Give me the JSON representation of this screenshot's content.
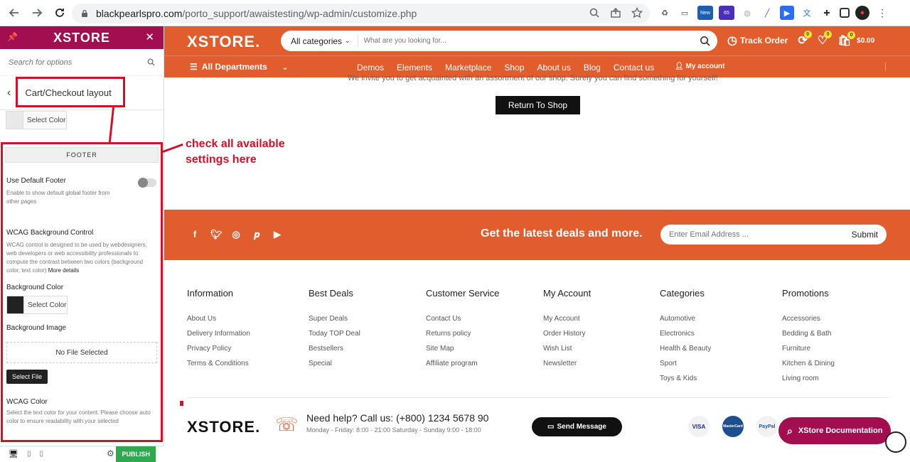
{
  "browser": {
    "url_host": "blackpearlspro.com",
    "url_path": "/porto_support/awaistesting/wp-admin/customize.php",
    "ext_new": "New",
    "ext_count": "65"
  },
  "sidebar": {
    "brand": "XSTORE",
    "search_placeholder": "Search for options",
    "breadcrumb": "Cart/Checkout layout",
    "color_top_label": "Select Color",
    "section_title": "FOOTER",
    "use_default_footer_label": "Use Default Footer",
    "use_default_footer_desc": "Enable to show default global footer from other pages",
    "wcag_bg_label": "WCAG Background Control",
    "wcag_bg_desc": "WCAG control is designed to be used by webdesigners, web developers or web accessibility professionals to compute the contrast between two colors (background color, text color)",
    "more_details": "More details",
    "bg_color_label": "Background Color",
    "bg_color_button": "Select Color",
    "bg_image_label": "Background Image",
    "no_file": "No File Selected",
    "select_file": "Select File",
    "wcag_color_label": "WCAG Color",
    "wcag_color_desc": "Select the text color for your content. Please choose auto color to ensure readability with your selected",
    "publish": "PUBLISH"
  },
  "annotation": {
    "line1": "check all available",
    "line2": "settings here"
  },
  "header": {
    "logo": "XSTORE.",
    "category": "All categories",
    "search_placeholder": "What are you looking for...",
    "track_order": "Track Order",
    "compare_count": "0",
    "wishlist_count": "0",
    "cart_count": "0",
    "cart_total": "$0.00",
    "all_departments": "All Departments",
    "menu": [
      "Demos",
      "Elements",
      "Marketplace",
      "Shop",
      "About us",
      "Blog",
      "Contact us"
    ],
    "my_account": "My account"
  },
  "content": {
    "invite": "We invite you to get acquainted with an assortment of our shop. Surely you can find something for yourself!",
    "return_button": "Return To Shop"
  },
  "newsletter": {
    "headline": "Get the latest deals and more.",
    "email_placeholder": "Enter Email Address ...",
    "submit": "Submit"
  },
  "footer_columns": [
    {
      "title": "Information",
      "links": [
        "About Us",
        "Delivery Information",
        "Privacy Policy",
        "Terms & Conditions"
      ]
    },
    {
      "title": "Best Deals",
      "links": [
        "Super Deals",
        "Today TOP Deal",
        "Bestsellers",
        "Special"
      ]
    },
    {
      "title": "Customer Service",
      "links": [
        "Contact Us",
        "Returns policy",
        "Site Map",
        "Affiliate program"
      ]
    },
    {
      "title": "My Account",
      "links": [
        "My Account",
        "Order History",
        "Wish List",
        "Newsletter"
      ]
    },
    {
      "title": "Categories",
      "links": [
        "Automotive",
        "Electronics",
        "Health & Beauty",
        "Sport",
        "Toys & Kids"
      ]
    },
    {
      "title": "Promotions",
      "links": [
        "Accessories",
        "Bedding & Bath",
        "Furniture",
        "Kitchen & Dining",
        "Living room"
      ]
    }
  ],
  "bottom": {
    "logo": "XSTORE.",
    "help": "Need help? Call us: (+800) 1234 5678 90",
    "hours": "Monday - Friday: 8:00 - 21:00 Saturday - Sunday 9:00 - 18:00",
    "send_message": "Send Message",
    "payments": [
      "VISA",
      "MasterCard",
      "PayPal"
    ],
    "doc_button": "XStore Documentation"
  },
  "colors": {
    "accent": "#e25d2d",
    "brand": "#a20e4f",
    "annotation": "#d3102a",
    "publish": "#2fa84f"
  }
}
